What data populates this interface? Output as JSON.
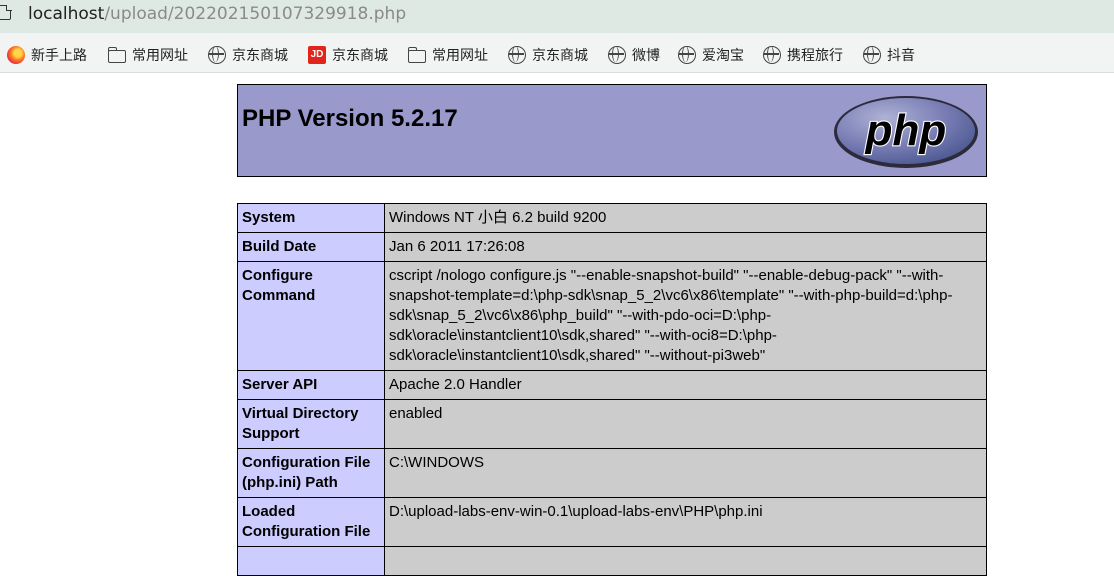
{
  "browser": {
    "url_host": "localhost",
    "url_path": "/upload/202202150107329918.php",
    "bookmarks": [
      {
        "label": "新手上路",
        "icon": "firefox-icon"
      },
      {
        "label": "常用网址",
        "icon": "folder-icon"
      },
      {
        "label": "京东商城",
        "icon": "globe-icon"
      },
      {
        "label": "京东商城",
        "icon": "jd-icon"
      },
      {
        "label": "常用网址",
        "icon": "folder-icon"
      },
      {
        "label": "京东商城",
        "icon": "globe-icon"
      },
      {
        "label": "微博",
        "icon": "globe-icon"
      },
      {
        "label": "爱淘宝",
        "icon": "globe-icon"
      },
      {
        "label": "携程旅行",
        "icon": "globe-icon"
      },
      {
        "label": "抖音",
        "icon": "globe-icon"
      }
    ],
    "jd_icon_text": "JD"
  },
  "phpinfo": {
    "title": "PHP Version 5.2.17",
    "logo_text": "php",
    "colors": {
      "header": "#9999cc",
      "key_cell": "#ccccff",
      "value_cell": "#cccccc"
    },
    "rows": [
      {
        "key": "System",
        "value": "Windows NT 小白 6.2 build 9200"
      },
      {
        "key": "Build Date",
        "value": "Jan 6 2011 17:26:08"
      },
      {
        "key": "Configure Command",
        "value": "cscript /nologo configure.js \"--enable-snapshot-build\" \"--enable-debug-pack\" \"--with-snapshot-template=d:\\php-sdk\\snap_5_2\\vc6\\x86\\template\" \"--with-php-build=d:\\php-sdk\\snap_5_2\\vc6\\x86\\php_build\" \"--with-pdo-oci=D:\\php-sdk\\oracle\\instantclient10\\sdk,shared\" \"--with-oci8=D:\\php-sdk\\oracle\\instantclient10\\sdk,shared\" \"--without-pi3web\""
      },
      {
        "key": "Server API",
        "value": "Apache 2.0 Handler"
      },
      {
        "key": "Virtual Directory Support",
        "value": "enabled"
      },
      {
        "key": "Configuration File (php.ini) Path",
        "value": "C:\\WINDOWS"
      },
      {
        "key": "Loaded Configuration File",
        "value": "D:\\upload-labs-env-win-0.1\\upload-labs-env\\PHP\\php.ini"
      },
      {
        "key": "",
        "value": ""
      }
    ]
  }
}
